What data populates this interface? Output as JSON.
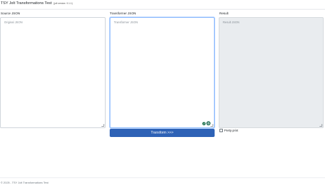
{
  "header": {
    "title": "TSY Jolt Transformations Test",
    "version": "(jolt version: 0.1.1)"
  },
  "columns": {
    "source": {
      "label": "Source JSON",
      "placeholder": "Original JSON"
    },
    "transformer": {
      "label": "Transformer JSON",
      "placeholder": "Transformer JSON"
    },
    "result": {
      "label": "Result",
      "placeholder": "Result JSON"
    }
  },
  "actions": {
    "transform_label": "Transform >>>"
  },
  "options": {
    "pretty_print_label": "Pretty print",
    "pretty_print_checked": false
  },
  "footer": {
    "text": "© 2025 - TSY Jolt Transformations Test"
  },
  "colors": {
    "primary_button": "#2e62b6",
    "focus_border": "#86b7fe",
    "readonly_bg": "#e9ecef"
  },
  "icons": {
    "tool_a": "edit-icon",
    "tool_b": "grammarly-icon"
  }
}
